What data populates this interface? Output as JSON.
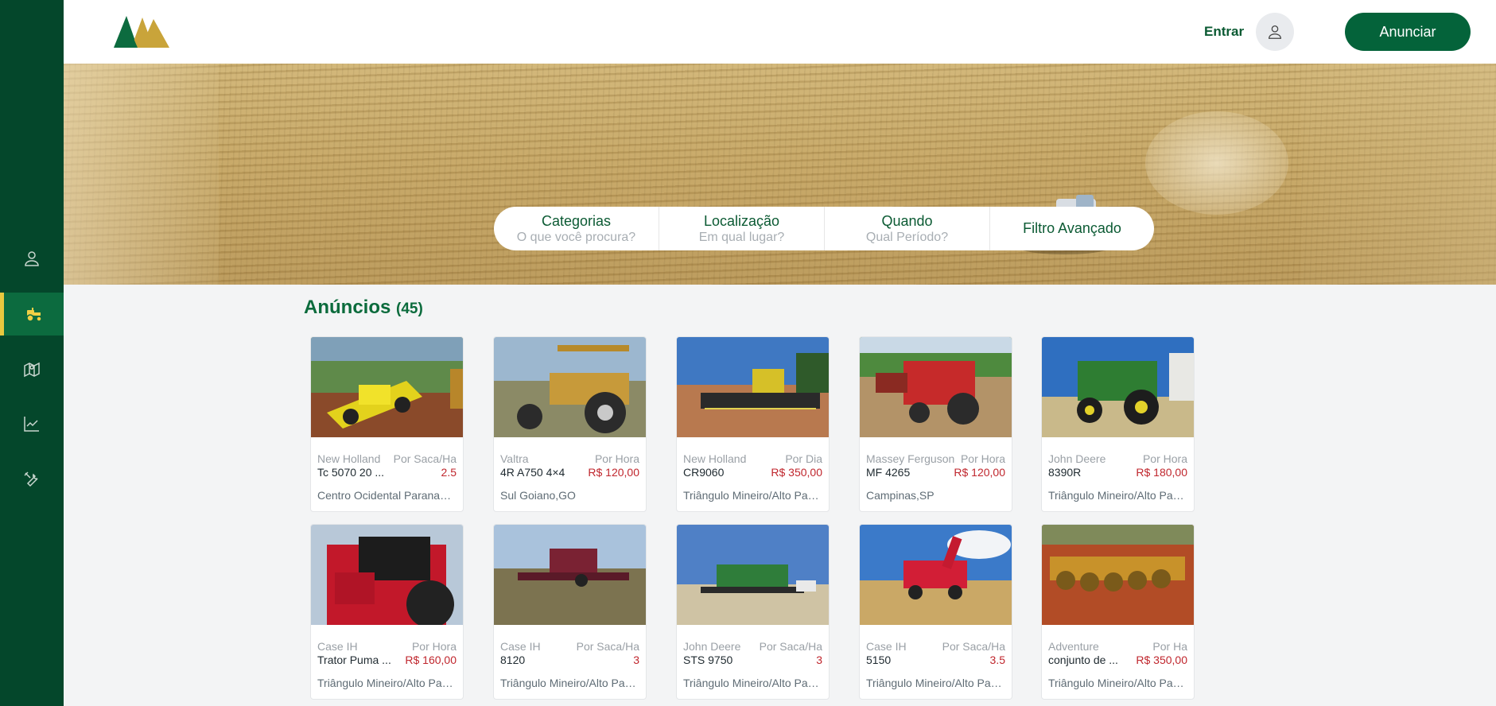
{
  "header": {
    "login_label": "Entrar",
    "announce_label": "Anunciar"
  },
  "search": {
    "categories_title": "Categorias",
    "categories_sub": "O que você procura?",
    "location_title": "Localização",
    "location_sub": "Em qual lugar?",
    "when_title": "Quando",
    "when_sub": "Qual Período?",
    "advanced_label": "Filtro Avançado"
  },
  "listings": {
    "title": "Anúncios",
    "count": "(45)",
    "cards": [
      {
        "brand": "New Holland",
        "unit": "Por Saca/Ha",
        "model": "Tc 5070 20 ...",
        "price": "2.5",
        "location": "Centro Ocidental Paranaense"
      },
      {
        "brand": "Valtra",
        "unit": "Por Hora",
        "model": "4R A750 4×4",
        "price": "R$ 120,00",
        "location": "Sul Goiano,GO"
      },
      {
        "brand": "New Holland",
        "unit": "Por Dia",
        "model": "CR9060",
        "price": "R$ 350,00",
        "location": "Triângulo Mineiro/Alto Paranaíba"
      },
      {
        "brand": "Massey Ferguson",
        "unit": "Por Hora",
        "model": "MF 4265",
        "price": "R$ 120,00",
        "location": "Campinas,SP"
      },
      {
        "brand": "John Deere",
        "unit": "Por Hora",
        "model": "8390R",
        "price": "R$ 180,00",
        "location": "Triângulo Mineiro/Alto Paranaíba"
      },
      {
        "brand": "Case IH",
        "unit": "Por Hora",
        "model": "Trator Puma ...",
        "price": "R$ 160,00",
        "location": "Triângulo Mineiro/Alto Paranaíba"
      },
      {
        "brand": "Case IH",
        "unit": "Por Saca/Ha",
        "model": "8120",
        "price": "3",
        "location": "Triângulo Mineiro/Alto Paranaíba"
      },
      {
        "brand": "John Deere",
        "unit": "Por Saca/Ha",
        "model": "STS 9750",
        "price": "3",
        "location": "Triângulo Mineiro/Alto Paranaíba"
      },
      {
        "brand": "Case IH",
        "unit": "Por Saca/Ha",
        "model": "5150",
        "price": "3.5",
        "location": "Triângulo Mineiro/Alto Paranaíba"
      },
      {
        "brand": "Adventure",
        "unit": "Por Ha",
        "model": "conjunto de ...",
        "price": "R$ 350,00",
        "location": "Triângulo Mineiro/Alto Paranaíba"
      }
    ]
  },
  "sidebar": {
    "items": [
      "user-icon",
      "tractor-icon",
      "map-icon",
      "chart-icon",
      "tools-icon"
    ]
  },
  "colors": {
    "brand_green": "#04472b",
    "accent_green": "#0c6b3f",
    "accent_gold": "#e8c83f",
    "price_red": "#c0262d"
  }
}
